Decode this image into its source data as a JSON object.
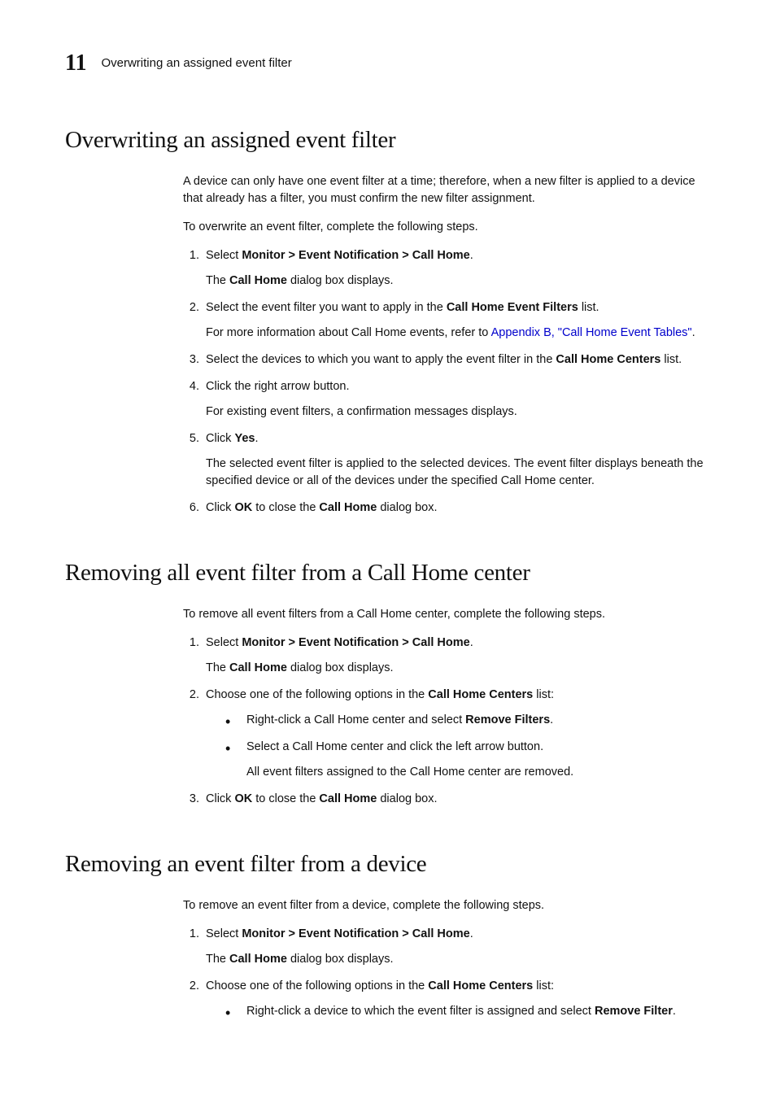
{
  "header": {
    "chapter": "11",
    "title": "Overwriting an assigned event filter"
  },
  "s1": {
    "heading": "Overwriting an assigned event filter",
    "intro": "A device can only have one event filter at a time; therefore, when a new filter is applied to a device that already has a filter, you must confirm the new filter assignment.",
    "lead": "To overwrite an event filter, complete the following steps.",
    "step1_a": "Select ",
    "step1_b": "Monitor > Event Notification > Call Home",
    "step1_c": ".",
    "step1_after_a": "The ",
    "step1_after_b": "Call Home",
    "step1_after_c": " dialog box displays.",
    "step2_a": "Select the event filter you want to apply in the ",
    "step2_b": "Call Home Event Filters",
    "step2_c": " list.",
    "step2_after_a": "For more information about Call Home events, refer to ",
    "step2_link": "Appendix B, \"Call Home Event Tables\"",
    "step2_after_b": ".",
    "step3_a": "Select the devices to which you want to apply the event filter in the ",
    "step3_b": "Call Home Centers",
    "step3_c": " list.",
    "step4": "Click the right arrow button.",
    "step4_after": "For existing event filters, a confirmation messages displays.",
    "step5_a": "Click ",
    "step5_b": "Yes",
    "step5_c": ".",
    "step5_after": "The selected event filter is applied to the selected devices. The event filter displays beneath the specified device or all of the devices under the specified Call Home center.",
    "step6_a": "Click ",
    "step6_b": "OK",
    "step6_c": " to close the ",
    "step6_d": "Call Home",
    "step6_e": " dialog box."
  },
  "s2": {
    "heading": "Removing all event filter from a Call Home center",
    "lead": "To remove all event filters from a Call Home center, complete the following steps.",
    "step1_a": "Select ",
    "step1_b": "Monitor > Event Notification > Call Home",
    "step1_c": ".",
    "step1_after_a": "The ",
    "step1_after_b": "Call Home",
    "step1_after_c": " dialog box displays.",
    "step2_a": "Choose one of the following options in the ",
    "step2_b": "Call Home Centers",
    "step2_c": " list:",
    "step2_b1_a": "Right-click a Call Home center and select ",
    "step2_b1_b": "Remove Filters",
    "step2_b1_c": ".",
    "step2_b2": "Select a Call Home center and click the left arrow button.",
    "step2_b2_after": "All event filters assigned to the Call Home center are removed.",
    "step3_a": "Click ",
    "step3_b": "OK",
    "step3_c": " to close the ",
    "step3_d": "Call Home",
    "step3_e": " dialog box."
  },
  "s3": {
    "heading": "Removing an event filter from a device",
    "lead": "To remove an event filter from a device, complete the following steps.",
    "step1_a": "Select ",
    "step1_b": "Monitor > Event Notification > Call Home",
    "step1_c": ".",
    "step1_after_a": "The ",
    "step1_after_b": "Call Home",
    "step1_after_c": " dialog box displays.",
    "step2_a": "Choose one of the following options in the ",
    "step2_b": "Call Home Centers",
    "step2_c": " list:",
    "step2_b1_a": "Right-click a device to which the event filter is assigned and select ",
    "step2_b1_b": "Remove Filter",
    "step2_b1_c": "."
  }
}
